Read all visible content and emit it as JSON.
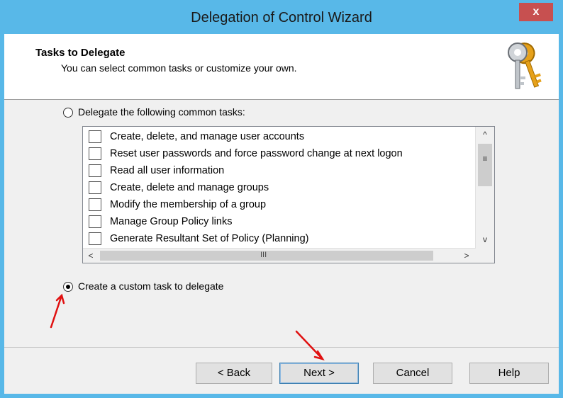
{
  "window": {
    "title": "Delegation of Control Wizard",
    "close_label": "x"
  },
  "header": {
    "title": "Tasks to Delegate",
    "subtitle": "You can select common tasks or customize your own.",
    "icon": "keys-icon"
  },
  "options": {
    "common": {
      "label": "Delegate the following common tasks:",
      "selected": false
    },
    "custom": {
      "label": "Create a custom task to delegate",
      "selected": true
    }
  },
  "tasks": [
    {
      "label": "Create, delete, and manage user accounts",
      "checked": false
    },
    {
      "label": "Reset user passwords and force password change at next logon",
      "checked": false
    },
    {
      "label": "Read all user information",
      "checked": false
    },
    {
      "label": "Create, delete and manage groups",
      "checked": false
    },
    {
      "label": "Modify the membership of a group",
      "checked": false
    },
    {
      "label": "Manage Group Policy links",
      "checked": false
    },
    {
      "label": "Generate Resultant Set of Policy (Planning)",
      "checked": false
    }
  ],
  "scrollbar": {
    "up": "^",
    "down": "v",
    "left": "<",
    "right": ">",
    "v_grip": "≡",
    "h_grip": "III"
  },
  "buttons": {
    "back": "< Back",
    "next": "Next >",
    "cancel": "Cancel",
    "help": "Help"
  },
  "colors": {
    "titlebar": "#58b8e8",
    "close": "#c75050",
    "arrow": "#e01010"
  }
}
